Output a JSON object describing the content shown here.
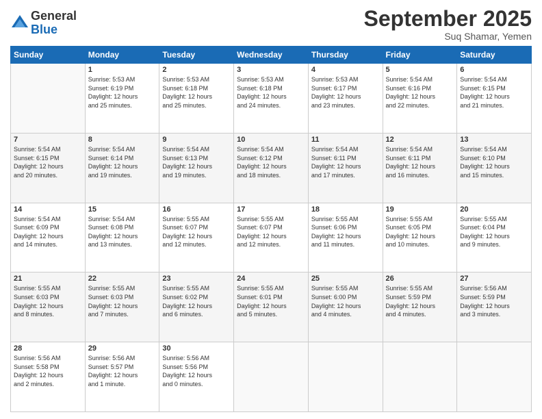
{
  "logo": {
    "general": "General",
    "blue": "Blue"
  },
  "header": {
    "month": "September 2025",
    "location": "Suq Shamar, Yemen"
  },
  "weekdays": [
    "Sunday",
    "Monday",
    "Tuesday",
    "Wednesday",
    "Thursday",
    "Friday",
    "Saturday"
  ],
  "weeks": [
    [
      {
        "day": "",
        "info": ""
      },
      {
        "day": "1",
        "info": "Sunrise: 5:53 AM\nSunset: 6:19 PM\nDaylight: 12 hours\nand 25 minutes."
      },
      {
        "day": "2",
        "info": "Sunrise: 5:53 AM\nSunset: 6:18 PM\nDaylight: 12 hours\nand 25 minutes."
      },
      {
        "day": "3",
        "info": "Sunrise: 5:53 AM\nSunset: 6:18 PM\nDaylight: 12 hours\nand 24 minutes."
      },
      {
        "day": "4",
        "info": "Sunrise: 5:53 AM\nSunset: 6:17 PM\nDaylight: 12 hours\nand 23 minutes."
      },
      {
        "day": "5",
        "info": "Sunrise: 5:54 AM\nSunset: 6:16 PM\nDaylight: 12 hours\nand 22 minutes."
      },
      {
        "day": "6",
        "info": "Sunrise: 5:54 AM\nSunset: 6:15 PM\nDaylight: 12 hours\nand 21 minutes."
      }
    ],
    [
      {
        "day": "7",
        "info": "Sunrise: 5:54 AM\nSunset: 6:15 PM\nDaylight: 12 hours\nand 20 minutes."
      },
      {
        "day": "8",
        "info": "Sunrise: 5:54 AM\nSunset: 6:14 PM\nDaylight: 12 hours\nand 19 minutes."
      },
      {
        "day": "9",
        "info": "Sunrise: 5:54 AM\nSunset: 6:13 PM\nDaylight: 12 hours\nand 19 minutes."
      },
      {
        "day": "10",
        "info": "Sunrise: 5:54 AM\nSunset: 6:12 PM\nDaylight: 12 hours\nand 18 minutes."
      },
      {
        "day": "11",
        "info": "Sunrise: 5:54 AM\nSunset: 6:11 PM\nDaylight: 12 hours\nand 17 minutes."
      },
      {
        "day": "12",
        "info": "Sunrise: 5:54 AM\nSunset: 6:11 PM\nDaylight: 12 hours\nand 16 minutes."
      },
      {
        "day": "13",
        "info": "Sunrise: 5:54 AM\nSunset: 6:10 PM\nDaylight: 12 hours\nand 15 minutes."
      }
    ],
    [
      {
        "day": "14",
        "info": "Sunrise: 5:54 AM\nSunset: 6:09 PM\nDaylight: 12 hours\nand 14 minutes."
      },
      {
        "day": "15",
        "info": "Sunrise: 5:54 AM\nSunset: 6:08 PM\nDaylight: 12 hours\nand 13 minutes."
      },
      {
        "day": "16",
        "info": "Sunrise: 5:55 AM\nSunset: 6:07 PM\nDaylight: 12 hours\nand 12 minutes."
      },
      {
        "day": "17",
        "info": "Sunrise: 5:55 AM\nSunset: 6:07 PM\nDaylight: 12 hours\nand 12 minutes."
      },
      {
        "day": "18",
        "info": "Sunrise: 5:55 AM\nSunset: 6:06 PM\nDaylight: 12 hours\nand 11 minutes."
      },
      {
        "day": "19",
        "info": "Sunrise: 5:55 AM\nSunset: 6:05 PM\nDaylight: 12 hours\nand 10 minutes."
      },
      {
        "day": "20",
        "info": "Sunrise: 5:55 AM\nSunset: 6:04 PM\nDaylight: 12 hours\nand 9 minutes."
      }
    ],
    [
      {
        "day": "21",
        "info": "Sunrise: 5:55 AM\nSunset: 6:03 PM\nDaylight: 12 hours\nand 8 minutes."
      },
      {
        "day": "22",
        "info": "Sunrise: 5:55 AM\nSunset: 6:03 PM\nDaylight: 12 hours\nand 7 minutes."
      },
      {
        "day": "23",
        "info": "Sunrise: 5:55 AM\nSunset: 6:02 PM\nDaylight: 12 hours\nand 6 minutes."
      },
      {
        "day": "24",
        "info": "Sunrise: 5:55 AM\nSunset: 6:01 PM\nDaylight: 12 hours\nand 5 minutes."
      },
      {
        "day": "25",
        "info": "Sunrise: 5:55 AM\nSunset: 6:00 PM\nDaylight: 12 hours\nand 4 minutes."
      },
      {
        "day": "26",
        "info": "Sunrise: 5:55 AM\nSunset: 5:59 PM\nDaylight: 12 hours\nand 4 minutes."
      },
      {
        "day": "27",
        "info": "Sunrise: 5:56 AM\nSunset: 5:59 PM\nDaylight: 12 hours\nand 3 minutes."
      }
    ],
    [
      {
        "day": "28",
        "info": "Sunrise: 5:56 AM\nSunset: 5:58 PM\nDaylight: 12 hours\nand 2 minutes."
      },
      {
        "day": "29",
        "info": "Sunrise: 5:56 AM\nSunset: 5:57 PM\nDaylight: 12 hours\nand 1 minute."
      },
      {
        "day": "30",
        "info": "Sunrise: 5:56 AM\nSunset: 5:56 PM\nDaylight: 12 hours\nand 0 minutes."
      },
      {
        "day": "",
        "info": ""
      },
      {
        "day": "",
        "info": ""
      },
      {
        "day": "",
        "info": ""
      },
      {
        "day": "",
        "info": ""
      }
    ]
  ]
}
